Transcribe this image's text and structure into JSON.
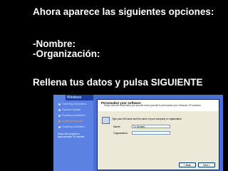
{
  "slide": {
    "line1": "Ahora aparece las siguientes opciones:",
    "line2": "-Nombre:",
    "line3": "-Organización:",
    "line4": "Rellena tus datos y pulsa SIGUIENTE"
  },
  "screenshot": {
    "logo": "Windows",
    "steps": [
      {
        "label": "Collecting information",
        "active": false
      },
      {
        "label": "Dynamic Update",
        "active": false
      },
      {
        "label": "Preparing installation",
        "active": false
      },
      {
        "label": "Installing Windows",
        "active": true
      },
      {
        "label": "Finalizing installation",
        "active": false
      }
    ],
    "note": "Setup will complete in approximately: 33 minutes",
    "dialog": {
      "title": "Personalize your software",
      "subtitle": "Setup uses the information you provide about yourself to personalize your Windows XP software.",
      "prompt": "Type your full name and the name of your company or organization.",
      "name_label": "Name:",
      "name_value": "Tu Nombre",
      "org_label": "Organization:",
      "org_value": "",
      "back_label": "< Back",
      "next_label": "Next >"
    }
  }
}
